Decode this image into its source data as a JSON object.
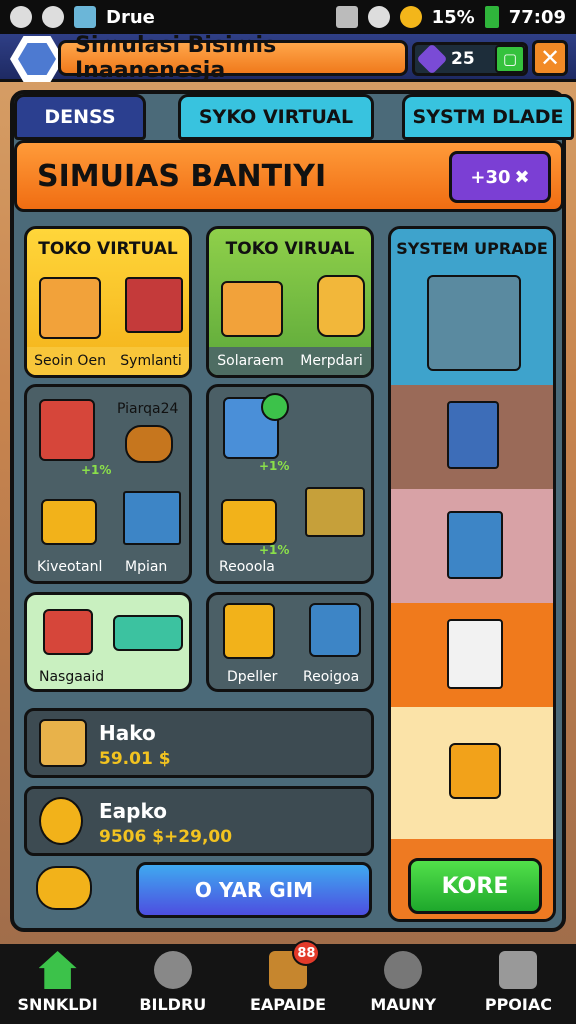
{
  "status_bar": {
    "carrier": "Drue",
    "signal": "15%",
    "time": "77:09"
  },
  "title_bar": {
    "title": "Simulasi Bisimis Inaanenesja",
    "gems": "25",
    "plus_icon": "square-icon",
    "close_icon": "x"
  },
  "tabs": [
    {
      "label": "DENSS"
    },
    {
      "label": "SYKO VIRTUAL"
    },
    {
      "label": "SYSTM DLADE"
    }
  ],
  "header": {
    "title": "SIMUIAS BANTIYI",
    "button_label": "+30"
  },
  "card_toko1": {
    "title": "TOKO VIRTUAL",
    "left_label": "Seoin Oen",
    "right_label": "Symlanti"
  },
  "card_toko2": {
    "title": "TOKO VIRUAL",
    "left_label": "Solaraem",
    "right_label": "Merpdari"
  },
  "card_items_a": {
    "top_right_label": "Piarqa24",
    "pct": "+1%",
    "bottom_left": "Kiveotanl",
    "bottom_right": "Mpian"
  },
  "card_items_b": {
    "pct_top": "+1%",
    "pct_bottom": "+1%",
    "bottom_left": "Reooola"
  },
  "card_items_c": {
    "label": "Nasgaaid"
  },
  "card_items_d": {
    "left": "Dpeller",
    "right": "Reoigoa"
  },
  "rows": [
    {
      "name": "Hako",
      "value": "59.01 $"
    },
    {
      "name": "Eapko",
      "value": "9506 $+29,00"
    }
  ],
  "side": {
    "title": "SYSTEM UPRADE"
  },
  "cta_label": "O YAR GIM",
  "more_label": "KORE",
  "nav": [
    {
      "label": "SNNKLDI",
      "icon": "home-icon"
    },
    {
      "label": "BILDRU",
      "icon": "globe-icon"
    },
    {
      "label": "EAPAIDE",
      "icon": "chest-icon",
      "badge": "88"
    },
    {
      "label": "MAUNY",
      "icon": "compass-icon"
    },
    {
      "label": "PPOIAC",
      "icon": "puzzle-icon"
    }
  ],
  "colors": {
    "accent_orange": "#f06d12",
    "panel": "#4b6a79",
    "tab_blue": "#38c3df",
    "title_blue": "#2b3f8f",
    "green": "#1ea82c"
  }
}
